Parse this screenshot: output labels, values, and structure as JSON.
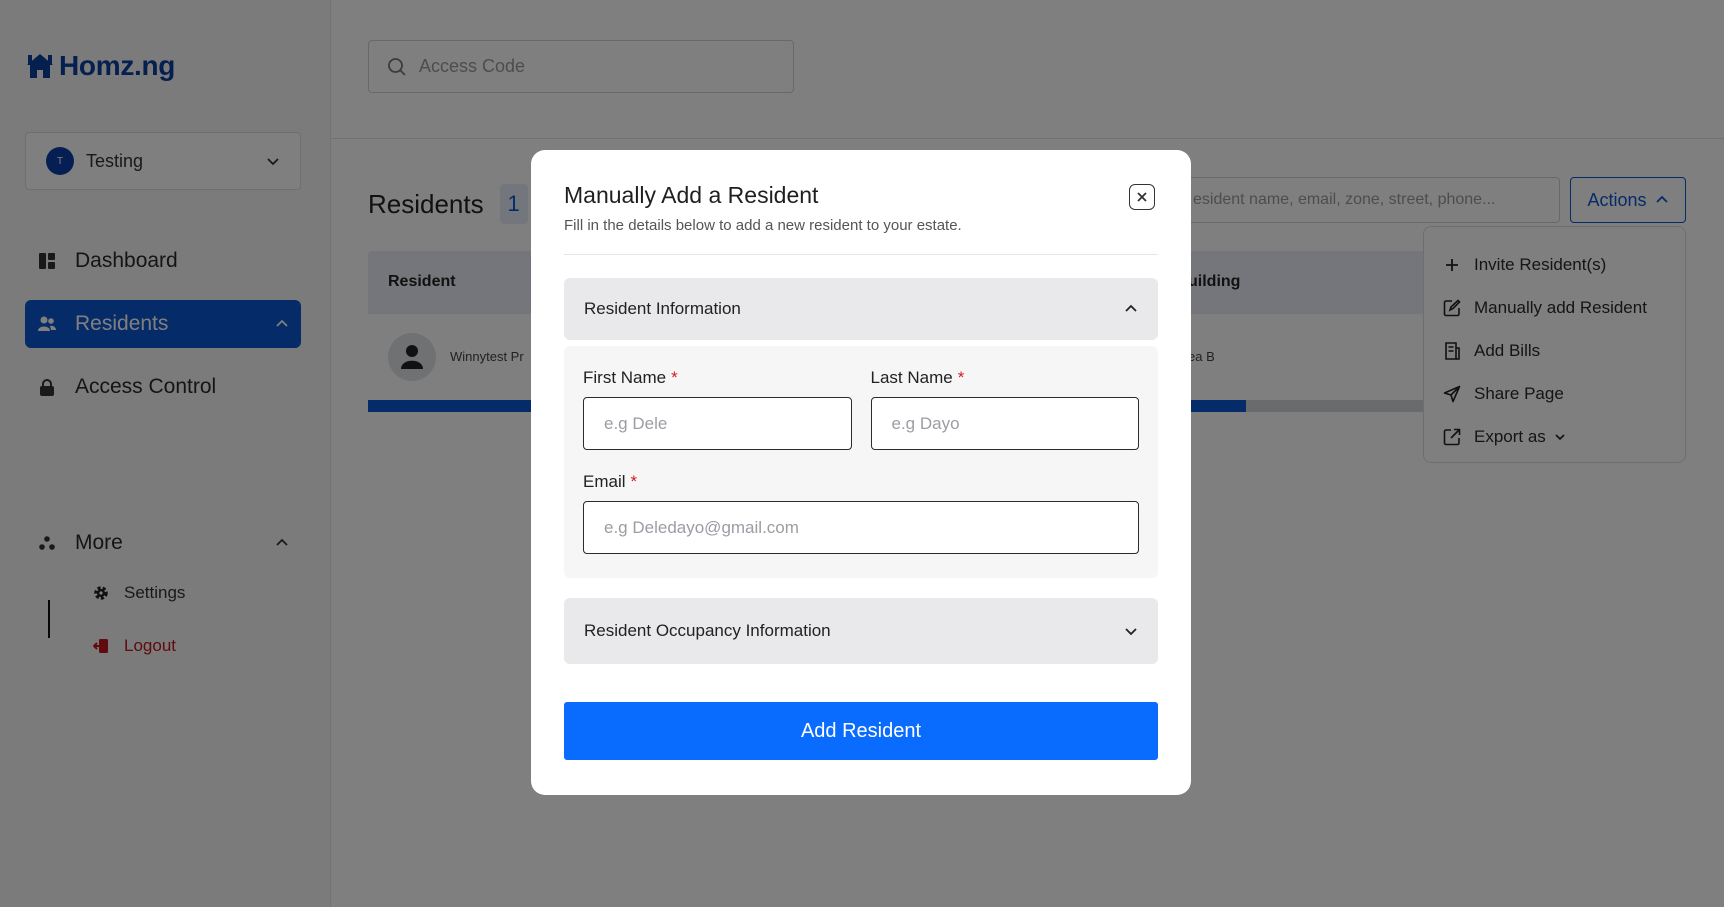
{
  "brand": {
    "name": "Homz.ng",
    "color": "#0b3f9e"
  },
  "estate": {
    "avatar_letter": "T",
    "name": "Testing"
  },
  "sidebar": {
    "items": [
      {
        "label": "Dashboard",
        "icon": "dashboard-icon"
      },
      {
        "label": "Residents",
        "icon": "users-icon",
        "active": true
      },
      {
        "label": "Access Control",
        "icon": "lock-icon"
      }
    ],
    "more": {
      "label": "More",
      "icon": "dots-icon"
    },
    "sub_items": [
      {
        "label": "Settings",
        "icon": "gear-icon"
      },
      {
        "label": "Logout",
        "icon": "logout-icon",
        "color": "#c0171b"
      }
    ]
  },
  "topbar": {
    "search_placeholder": "Access Code"
  },
  "residents": {
    "title": "Residents",
    "count": "1",
    "search_placeholder": "esident name, email, zone, street, phone...",
    "actions_label": "Actions",
    "table": {
      "headers": [
        "Resident",
        "uilding"
      ],
      "rows": [
        {
          "name": "Winnytest Pr",
          "area": "ea B"
        }
      ]
    },
    "progress": 0.666
  },
  "actions_menu": {
    "items": [
      {
        "label": "Invite Resident(s)",
        "icon": "plus-icon"
      },
      {
        "label": "Manually add Resident",
        "icon": "edit-icon"
      },
      {
        "label": "Add Bills",
        "icon": "bill-icon"
      },
      {
        "label": "Share Page",
        "icon": "send-icon"
      },
      {
        "label": "Export as",
        "icon": "external-link-icon"
      }
    ]
  },
  "modal": {
    "title": "Manually Add a Resident",
    "subtitle": "Fill in the details below to add a new resident to your estate.",
    "section1_title": "Resident Information",
    "first_name": {
      "label": "First Name",
      "required": "*",
      "placeholder": "e.g Dele"
    },
    "last_name": {
      "label": "Last Name",
      "required": "*",
      "placeholder": "e.g Dayo"
    },
    "email": {
      "label": "Email",
      "required": "*",
      "placeholder": "e.g Deledayo@gmail.com"
    },
    "section2_title": "Resident Occupancy Information",
    "submit_label": "Add Resident",
    "submit_color": "#0a6cff"
  }
}
